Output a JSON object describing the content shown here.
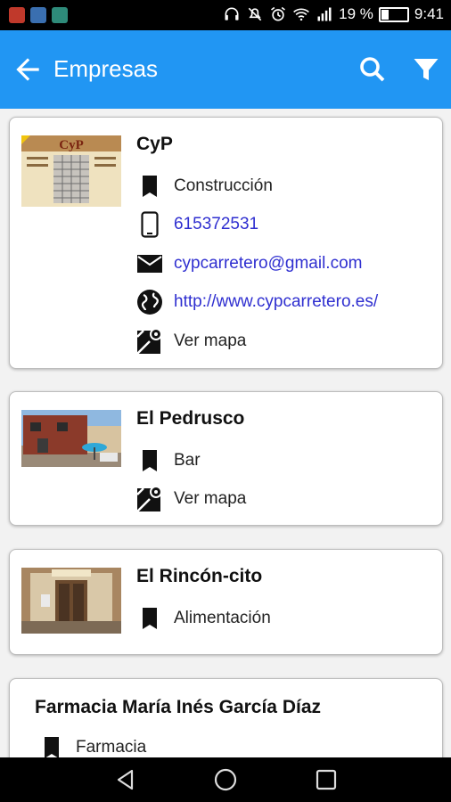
{
  "status_bar": {
    "battery": "19 %",
    "time": "9:41"
  },
  "app_bar": {
    "title": "Empresas"
  },
  "businesses": [
    {
      "name": "CyP",
      "category": "Construcción",
      "phone": "615372531",
      "email": "cypcarretero@gmail.com",
      "website": "http://www.cypcarretero.es/",
      "map": "Ver mapa",
      "logo_text": "CyP"
    },
    {
      "name": "El Pedrusco",
      "category": "Bar",
      "map": "Ver mapa"
    },
    {
      "name": "El Rincón-cito",
      "category": "Alimentación"
    },
    {
      "name": "Farmacia María Inés García Díaz",
      "category": "Farmacia"
    }
  ]
}
